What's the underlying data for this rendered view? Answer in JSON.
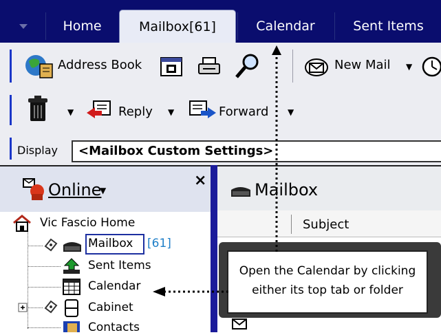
{
  "tabs": [
    {
      "label": "Home"
    },
    {
      "label": "Mailbox[61]"
    },
    {
      "label": "Calendar"
    },
    {
      "label": "Sent Items"
    }
  ],
  "toolbar1": {
    "address_book": "Address Book",
    "new_mail": "New Mail"
  },
  "toolbar2": {
    "reply": "Reply",
    "forward": "Forward"
  },
  "display": {
    "label": "Display",
    "value": "<Mailbox Custom Settings>"
  },
  "folder_pane": {
    "online_label": "Online",
    "close": "×",
    "tree": {
      "home": "Vic Fascio Home",
      "mailbox": "Mailbox",
      "mailbox_count": "[61]",
      "sent_items": "Sent Items",
      "calendar": "Calendar",
      "cabinet": "Cabinet",
      "contacts": "Contacts"
    }
  },
  "content": {
    "title": "Mailbox",
    "subject_header": "Subject"
  },
  "callout": {
    "line1": "Open the Calendar by clicking",
    "line2": "either its top tab or folder"
  },
  "colors": {
    "tabbar": "#0a0d6e",
    "active_tab": "#e8ebf6",
    "highlight_box": "#1c2fa0",
    "pane_divider": "#1b1b9a"
  },
  "icons": [
    "chevron-down-icon",
    "address-book-icon",
    "calendar-view-icon",
    "print-icon",
    "find-icon",
    "new-mail-icon",
    "clock-icon",
    "trash-icon",
    "reply-icon",
    "forward-icon",
    "online-status-icon",
    "home-icon",
    "mailbox-icon",
    "sent-items-icon",
    "calendar-folder-icon",
    "cabinet-icon",
    "contacts-icon"
  ]
}
